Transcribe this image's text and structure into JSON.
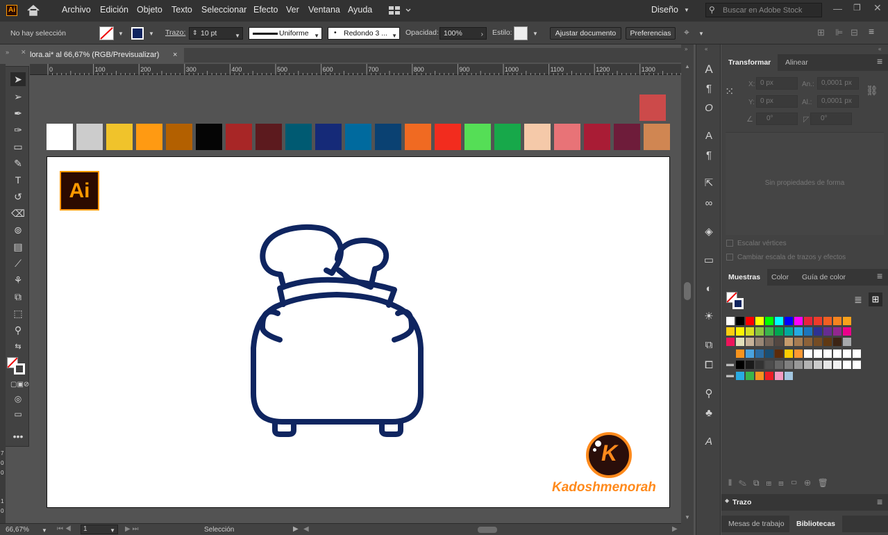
{
  "app": {
    "logo": "Ai"
  },
  "menu": [
    "Archivo",
    "Edición",
    "Objeto",
    "Texto",
    "Seleccionar",
    "Efecto",
    "Ver",
    "Ventana",
    "Ayuda"
  ],
  "workspace": "Diseño",
  "search": {
    "placeholder": "Buscar en Adobe Stock"
  },
  "control": {
    "selection": "No hay selección",
    "stroke_label": "Trazo:",
    "stroke_value": "10 pt",
    "profile": "Uniforme",
    "brush": "Redondo 3 ...",
    "opacity_label": "Opacidad:",
    "opacity_value": "100%",
    "style_label": "Estilo:",
    "adjust_button": "Ajustar documento",
    "prefs_button": "Preferencias"
  },
  "document": {
    "tab_title": "lora.ai* al 66,67% (RGB/Previsualizar)",
    "close": "×"
  },
  "ruler_marks": [
    "0",
    "100",
    "200",
    "300",
    "400",
    "500",
    "600",
    "700",
    "800",
    "900",
    "1000",
    "1100",
    "1200",
    "1300"
  ],
  "vruler_marks": [
    "7",
    "0",
    "0",
    "1",
    "0"
  ],
  "swatch_row": [
    "#ffffff",
    "#cccccc",
    "#f0c32b",
    "#ff9a12",
    "#b36000",
    "#050505",
    "#a82626",
    "#5c1a1e",
    "#005a72",
    "#152a78",
    "#006a9e",
    "#0a4172",
    "#f06a22",
    "#f22c1e",
    "#55de56",
    "#17a84a",
    "#f5c9a9",
    "#e87377",
    "#a91c35",
    "#6e1c3a",
    "#d08652"
  ],
  "swatch_top": "#cc4a4a",
  "artwork": {
    "logo_text": "Ai",
    "brand": "Kadoshmenorah",
    "brand_letter": "K",
    "stroke_color": "#0f2560"
  },
  "status": {
    "zoom": "66,67%",
    "page": "1",
    "tool": "Selección"
  },
  "transform": {
    "tab": "Transformar",
    "tab2": "Alinear",
    "x_label": "X:",
    "x": "0 px",
    "w_label": "An.:",
    "w": "0,0001 px",
    "y_label": "Y:",
    "y": "0 px",
    "h_label": "Al.:",
    "h": "0,0001 px",
    "angle": "0°",
    "shear": "0°",
    "empty": "Sin propiedades de forma",
    "scale_corners": "Escalar vértices",
    "scale_strokes": "Cambiar escala de trazos y efectos"
  },
  "swatches_panel": {
    "tabs": [
      "Muestras",
      "Color",
      "Guía de color"
    ],
    "rows": [
      [
        "#ffffff",
        "#000000",
        "#ff0000",
        "#ffff00",
        "#00ff00",
        "#00ffff",
        "#0000ff",
        "#ff00ff",
        "#e8233a",
        "#ee3b2b",
        "#f15f22",
        "#f5841f",
        "#f9a11b"
      ],
      [
        "#fccd11",
        "#fff200",
        "#d7df23",
        "#8dc63f",
        "#39b54a",
        "#00a651",
        "#00a99d",
        "#27aae1",
        "#1c75bc",
        "#2e3192",
        "#662d91",
        "#92278f",
        "#ec008c"
      ],
      [
        "#ed145b",
        "#e2dfba",
        "#c7b299",
        "#998675",
        "#736357",
        "#534741",
        "#c69c6d",
        "#a67c52",
        "#8c6239",
        "#754c24",
        "#603913",
        "#3c2415",
        "#a7a9ac"
      ],
      [
        "#f7941d",
        "#4aa3df",
        "#2b6ca3",
        "#1a4e73",
        "#5c2b0a",
        "#ffcc00",
        "#ff9933",
        "#ffffff",
        "#ffffff",
        "#ffffff",
        "#ffffff",
        "#ffffff",
        "#ffffff"
      ],
      [
        "#000000",
        "#1a1a1a",
        "#333333",
        "#4d4d4d",
        "#666666",
        "#808080",
        "#999999",
        "#b3b3b3",
        "#cccccc",
        "#e6e6e6",
        "#f2f2f2",
        "#ffffff",
        "#ffffff"
      ],
      [
        "#29abe2",
        "#39b54a",
        "#f7931e",
        "#ed1c24",
        "#f49ac1",
        "#a3c6e0"
      ]
    ]
  },
  "stroke_panel": {
    "title": "Trazo"
  },
  "bottom_tabs": {
    "a": "Mesas de trabajo",
    "b": "Bibliotecas"
  },
  "colors": {
    "accent": "#ff9a00",
    "ui_dark": "#323232",
    "ui_mid": "#424242",
    "canvas": "#535353"
  }
}
